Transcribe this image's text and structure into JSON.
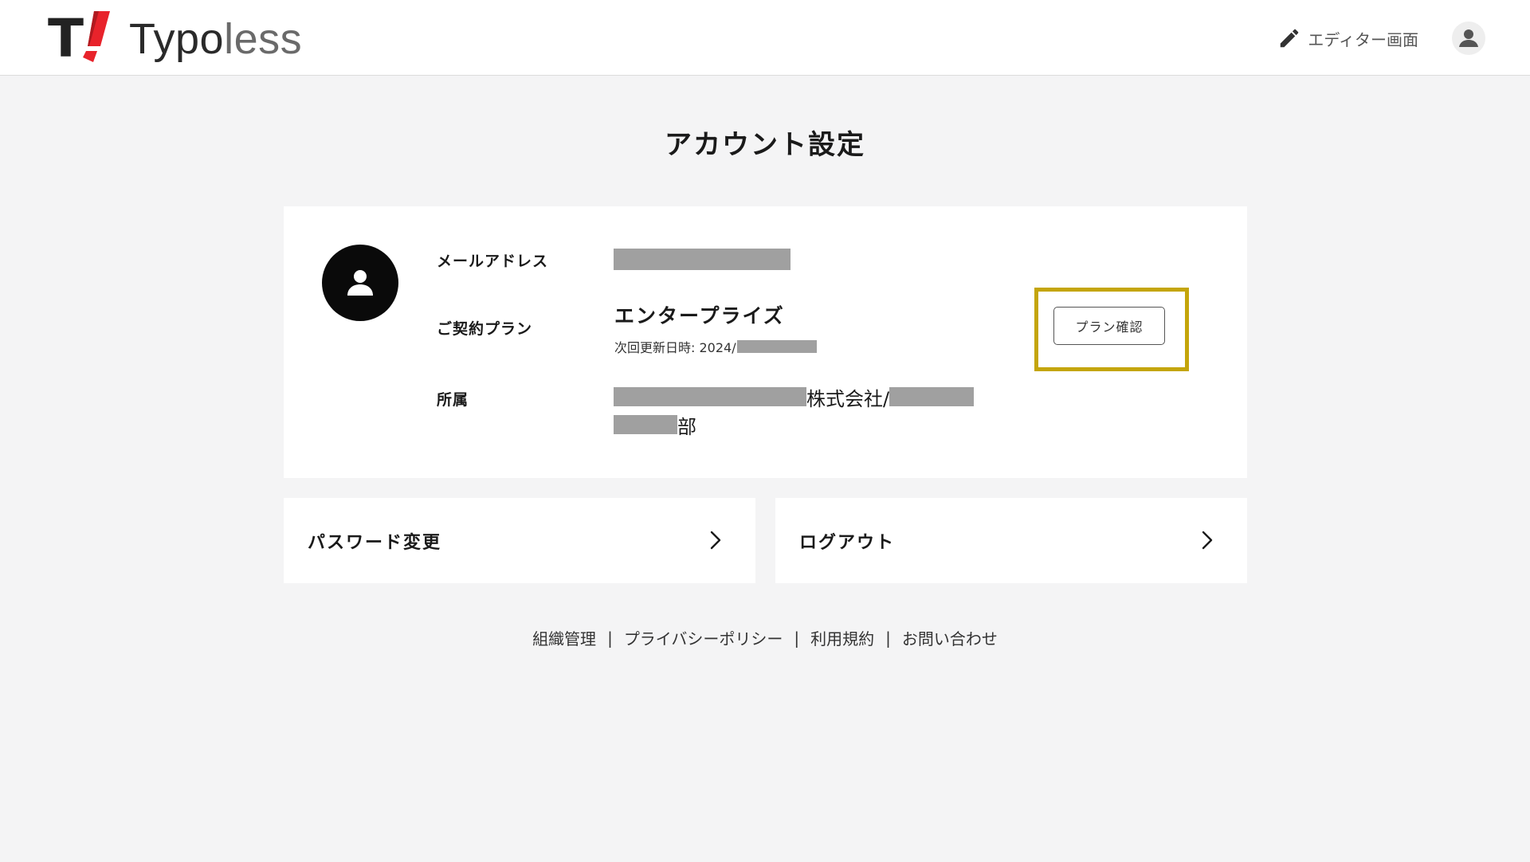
{
  "header": {
    "logo_text_strong": "Typo",
    "logo_text_light": "less",
    "editor_link_label": "エディター画面"
  },
  "page": {
    "title": "アカウント設定"
  },
  "profile": {
    "email_label": "メールアドレス",
    "plan_label": "ご契約プラン",
    "plan_name": "エンタープライズ",
    "renewal_prefix": "次回更新日時: 2024/",
    "plan_button_label": "プラン確認",
    "org_label": "所属",
    "org_company_suffix": "株式会社/",
    "org_dept_suffix": "部"
  },
  "actions": {
    "password_label": "パスワード変更",
    "logout_label": "ログアウト"
  },
  "footer": {
    "links": [
      "組織管理",
      "プライバシーポリシー",
      "利用規約",
      "お問い合わせ"
    ],
    "separator": "|"
  },
  "colors": {
    "highlight": "#c4a50a",
    "logo_red": "#e8232b",
    "background": "#f4f4f5",
    "redaction": "#a0a0a0"
  },
  "icons": {
    "editor": "pencil-icon",
    "user_menu": "user-circle-icon",
    "avatar": "person-icon",
    "chevron": "chevron-right-icon"
  }
}
